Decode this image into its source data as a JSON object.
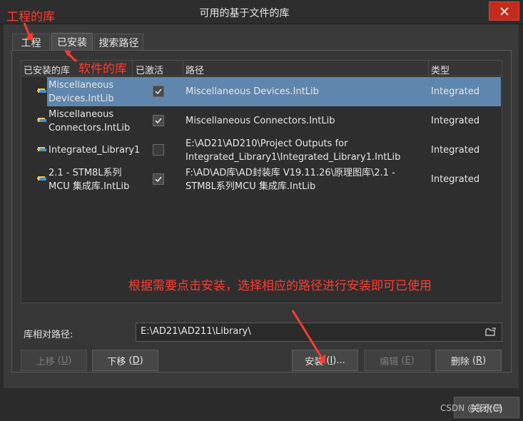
{
  "window": {
    "title": "可用的基于文件的库"
  },
  "tabs": [
    {
      "label": "工程",
      "active": false
    },
    {
      "label": "已安装",
      "active": true
    },
    {
      "label": "搜索路径",
      "active": false
    }
  ],
  "table": {
    "headers": {
      "library": "已安装的库",
      "active": "已激活",
      "path": "路径",
      "type": "类型"
    },
    "rows": [
      {
        "name_line1": "Miscellaneous",
        "name_line2": "Devices.IntLib",
        "active": true,
        "path_line1": "Miscellaneous Devices.IntLib",
        "path_line2": "",
        "type": "Integrated",
        "selected": true
      },
      {
        "name_line1": "Miscellaneous",
        "name_line2": "Connectors.IntLib",
        "active": true,
        "path_line1": "Miscellaneous Connectors.IntLib",
        "path_line2": "",
        "type": "Integrated",
        "selected": false
      },
      {
        "name_line1": "Integrated_Library1",
        "name_line2": "",
        "active": false,
        "path_line1": "E:\\AD21\\AD210\\Project Outputs for",
        "path_line2": "Integrated_Library1\\Integrated_Library1.IntLib",
        "type": "Integrated",
        "selected": false
      },
      {
        "name_line1": "2.1 - STM8L系列",
        "name_line2": "MCU 集成库.IntLib",
        "active": true,
        "path_line1": "F:\\AD\\AD库\\AD封装库 V19.11.26\\原理图库\\2.1 -",
        "path_line2": "STM8L系列MCU 集成库.IntLib",
        "type": "Integrated",
        "selected": false
      }
    ]
  },
  "relative_path": {
    "label": "库相对路径:",
    "value": "E:\\AD21\\AD211\\Library\\"
  },
  "buttons": {
    "move_up": {
      "label": "上移",
      "shortcut": "U"
    },
    "move_down": {
      "label": "下移",
      "shortcut": "D"
    },
    "install": {
      "label": "安装",
      "shortcut": "I",
      "suffix": "..."
    },
    "edit": {
      "label": "编辑",
      "shortcut": "E"
    },
    "remove": {
      "label": "删除",
      "shortcut": "R"
    },
    "close": "关闭(C)"
  },
  "annotations": {
    "project_lib": "工程的库",
    "software_lib": "软件的库",
    "instruction": "根据需要点击安装，选择相应的路径进行安装即可已使用"
  },
  "watermark": "CSDN @彭火研",
  "colors": {
    "selection": "#5f86ad",
    "annotation": "#ff3b2f",
    "close_button": "#c42b1c"
  }
}
